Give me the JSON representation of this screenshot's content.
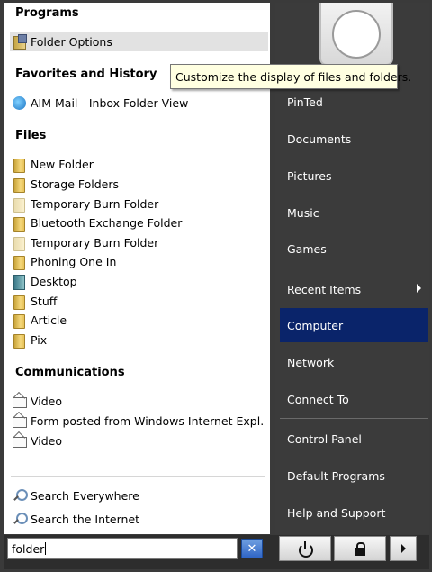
{
  "tooltip": "Customize the display of files and folders.",
  "left": {
    "programs": {
      "heading": "Programs",
      "items": [
        {
          "label": "Folder Options",
          "icon": "folder-options-icon"
        }
      ]
    },
    "favorites": {
      "heading": "Favorites and History",
      "items": [
        {
          "label": "AIM Mail - Inbox Folder View",
          "icon": "aim-icon"
        }
      ]
    },
    "files": {
      "heading": "Files",
      "items": [
        {
          "label": "New Folder",
          "icon": "folder-icon"
        },
        {
          "label": "Storage Folders",
          "icon": "folder-icon"
        },
        {
          "label": "Temporary Burn Folder",
          "icon": "folder-icon"
        },
        {
          "label": "Bluetooth Exchange Folder",
          "icon": "folder-icon"
        },
        {
          "label": "Temporary Burn Folder",
          "icon": "folder-icon"
        },
        {
          "label": "Phoning One In",
          "icon": "folder-icon"
        },
        {
          "label": "Desktop",
          "icon": "desktop-icon"
        },
        {
          "label": "Stuff",
          "icon": "folder-icon"
        },
        {
          "label": "Article",
          "icon": "folder-icon"
        },
        {
          "label": "Pix",
          "icon": "folder-icon"
        }
      ]
    },
    "communications": {
      "heading": "Communications",
      "items": [
        {
          "label": "Video",
          "icon": "mail-icon"
        },
        {
          "label": "Form posted from Windows Internet Expl...",
          "icon": "mail-icon"
        },
        {
          "label": "Video",
          "icon": "mail-icon"
        }
      ]
    },
    "search_links": [
      {
        "label": "Search Everywhere",
        "icon": "search-icon"
      },
      {
        "label": "Search the Internet",
        "icon": "search-icon"
      }
    ]
  },
  "right": {
    "items": [
      {
        "label": "PinTed"
      },
      {
        "label": "Documents"
      },
      {
        "label": "Pictures"
      },
      {
        "label": "Music"
      },
      {
        "label": "Games"
      },
      {
        "label": "Recent Items"
      },
      {
        "label": "Computer"
      },
      {
        "label": "Network"
      },
      {
        "label": "Connect To"
      },
      {
        "label": "Control Panel"
      },
      {
        "label": "Default Programs"
      },
      {
        "label": "Help and Support"
      }
    ]
  },
  "search": {
    "value": "folder"
  },
  "colors": {
    "highlight": "#0a246a",
    "tooltip_bg": "#ffffe1",
    "hover_bg": "#e2e2e2"
  }
}
